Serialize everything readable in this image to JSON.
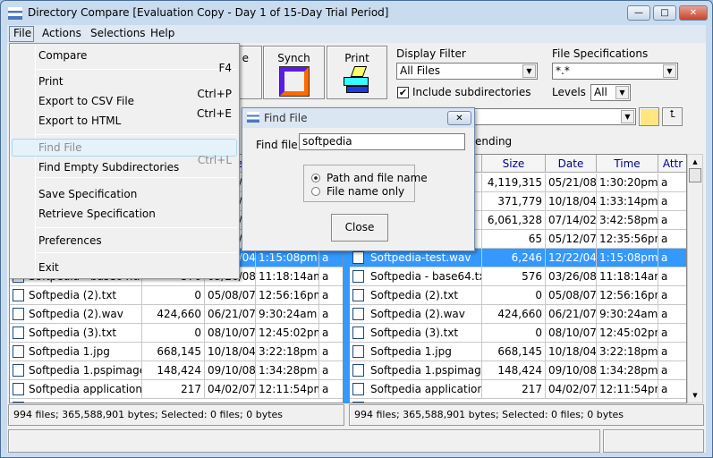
{
  "window": {
    "title": "Directory Compare [Evaluation Copy - Day 1 of 15-Day Trial Period]",
    "minimize": "—",
    "maximize": "□",
    "close": "✕"
  },
  "menubar": [
    "File",
    "Actions",
    "Selections",
    "Help"
  ],
  "toolbar": {
    "synch": "Synch",
    "print": "Print",
    "compare_partial": "e"
  },
  "filter": {
    "display_filter_label": "Display Filter",
    "display_filter_value": "All Files",
    "include_subdirs_label": "Include subdirectories",
    "include_subdirs_checked": true,
    "file_spec_label": "File Specifications",
    "file_spec_value": "*.*",
    "levels_label": "Levels",
    "levels_value": "All"
  },
  "sort_partial": "ending",
  "columns": {
    "size": "Size",
    "date": "Date",
    "time": "Time",
    "attr": "Attr"
  },
  "rows": [
    {
      "name": "",
      "size": "4,119,315",
      "date": "05/21/08",
      "time": "1:30:20pm",
      "attr": "a"
    },
    {
      "name": "",
      "size": "371,779",
      "date": "10/18/04",
      "time": "1:33:14pm",
      "attr": "a"
    },
    {
      "name": "",
      "size": "6,061,328",
      "date": "07/14/02",
      "time": "3:42:58pm",
      "attr": "a"
    },
    {
      "name": "",
      "size": "65",
      "date": "05/12/07",
      "time": "12:35:56pm",
      "attr": "a"
    },
    {
      "name": "Softpedia-test.wav",
      "size": "6,246",
      "date": "12/22/04",
      "time": "1:15:08pm",
      "attr": "a",
      "selected": true
    },
    {
      "name": "Softpedia - base64.txt",
      "size": "576",
      "date": "03/26/08",
      "time": "11:18:14am",
      "attr": "a"
    },
    {
      "name": "Softpedia (2).txt",
      "size": "0",
      "date": "05/08/07",
      "time": "12:56:16pm",
      "attr": "a"
    },
    {
      "name": "Softpedia (2).wav",
      "size": "424,660",
      "date": "06/21/07",
      "time": "9:30:24am",
      "attr": "a"
    },
    {
      "name": "Softpedia (3).txt",
      "size": "0",
      "date": "08/10/07",
      "time": "12:45:02pm",
      "attr": "a"
    },
    {
      "name": "Softpedia 1.jpg",
      "size": "668,145",
      "date": "10/18/04",
      "time": "3:22:18pm",
      "attr": "a"
    },
    {
      "name": "Softpedia 1.pspimage",
      "size": "148,424",
      "date": "09/10/08",
      "time": "1:34:28pm",
      "attr": "a"
    },
    {
      "name": "Softpedia application.gif",
      "size": "217",
      "date": "04/02/07",
      "time": "12:11:54pm",
      "attr": "a"
    }
  ],
  "status": {
    "left": "994 files; 365,588,901 bytes;  Selected: 0 files; 0 bytes",
    "right": "994 files; 365,588,901 bytes;  Selected: 0 files; 0 bytes"
  },
  "file_menu": [
    {
      "label": "Compare",
      "shortcut": "F4"
    },
    {
      "label": "Print",
      "shortcut": "Ctrl+P"
    },
    {
      "label": "Export to CSV File",
      "shortcut": "Ctrl+E"
    },
    {
      "label": "Export to HTML",
      "shortcut": ""
    },
    {
      "label": "Find File",
      "shortcut": "Ctrl+L",
      "disabled": true,
      "highlighted": true
    },
    {
      "label": "Find Empty Subdirectories",
      "shortcut": ""
    },
    {
      "label": "Save Specification",
      "shortcut": ""
    },
    {
      "label": "Retrieve Specification",
      "shortcut": ""
    },
    {
      "label": "Preferences",
      "shortcut": ""
    },
    {
      "label": "Exit",
      "shortcut": ""
    }
  ],
  "find_dialog": {
    "title": "Find File",
    "find_label": "Find file:",
    "find_value": "softpedia",
    "option_path": "Path and file name",
    "option_name": "File name only",
    "selected_option": "Path and file name",
    "close": "Close"
  },
  "colors": {
    "selection": "#3399ff",
    "title_bar": "#c9dbef"
  }
}
